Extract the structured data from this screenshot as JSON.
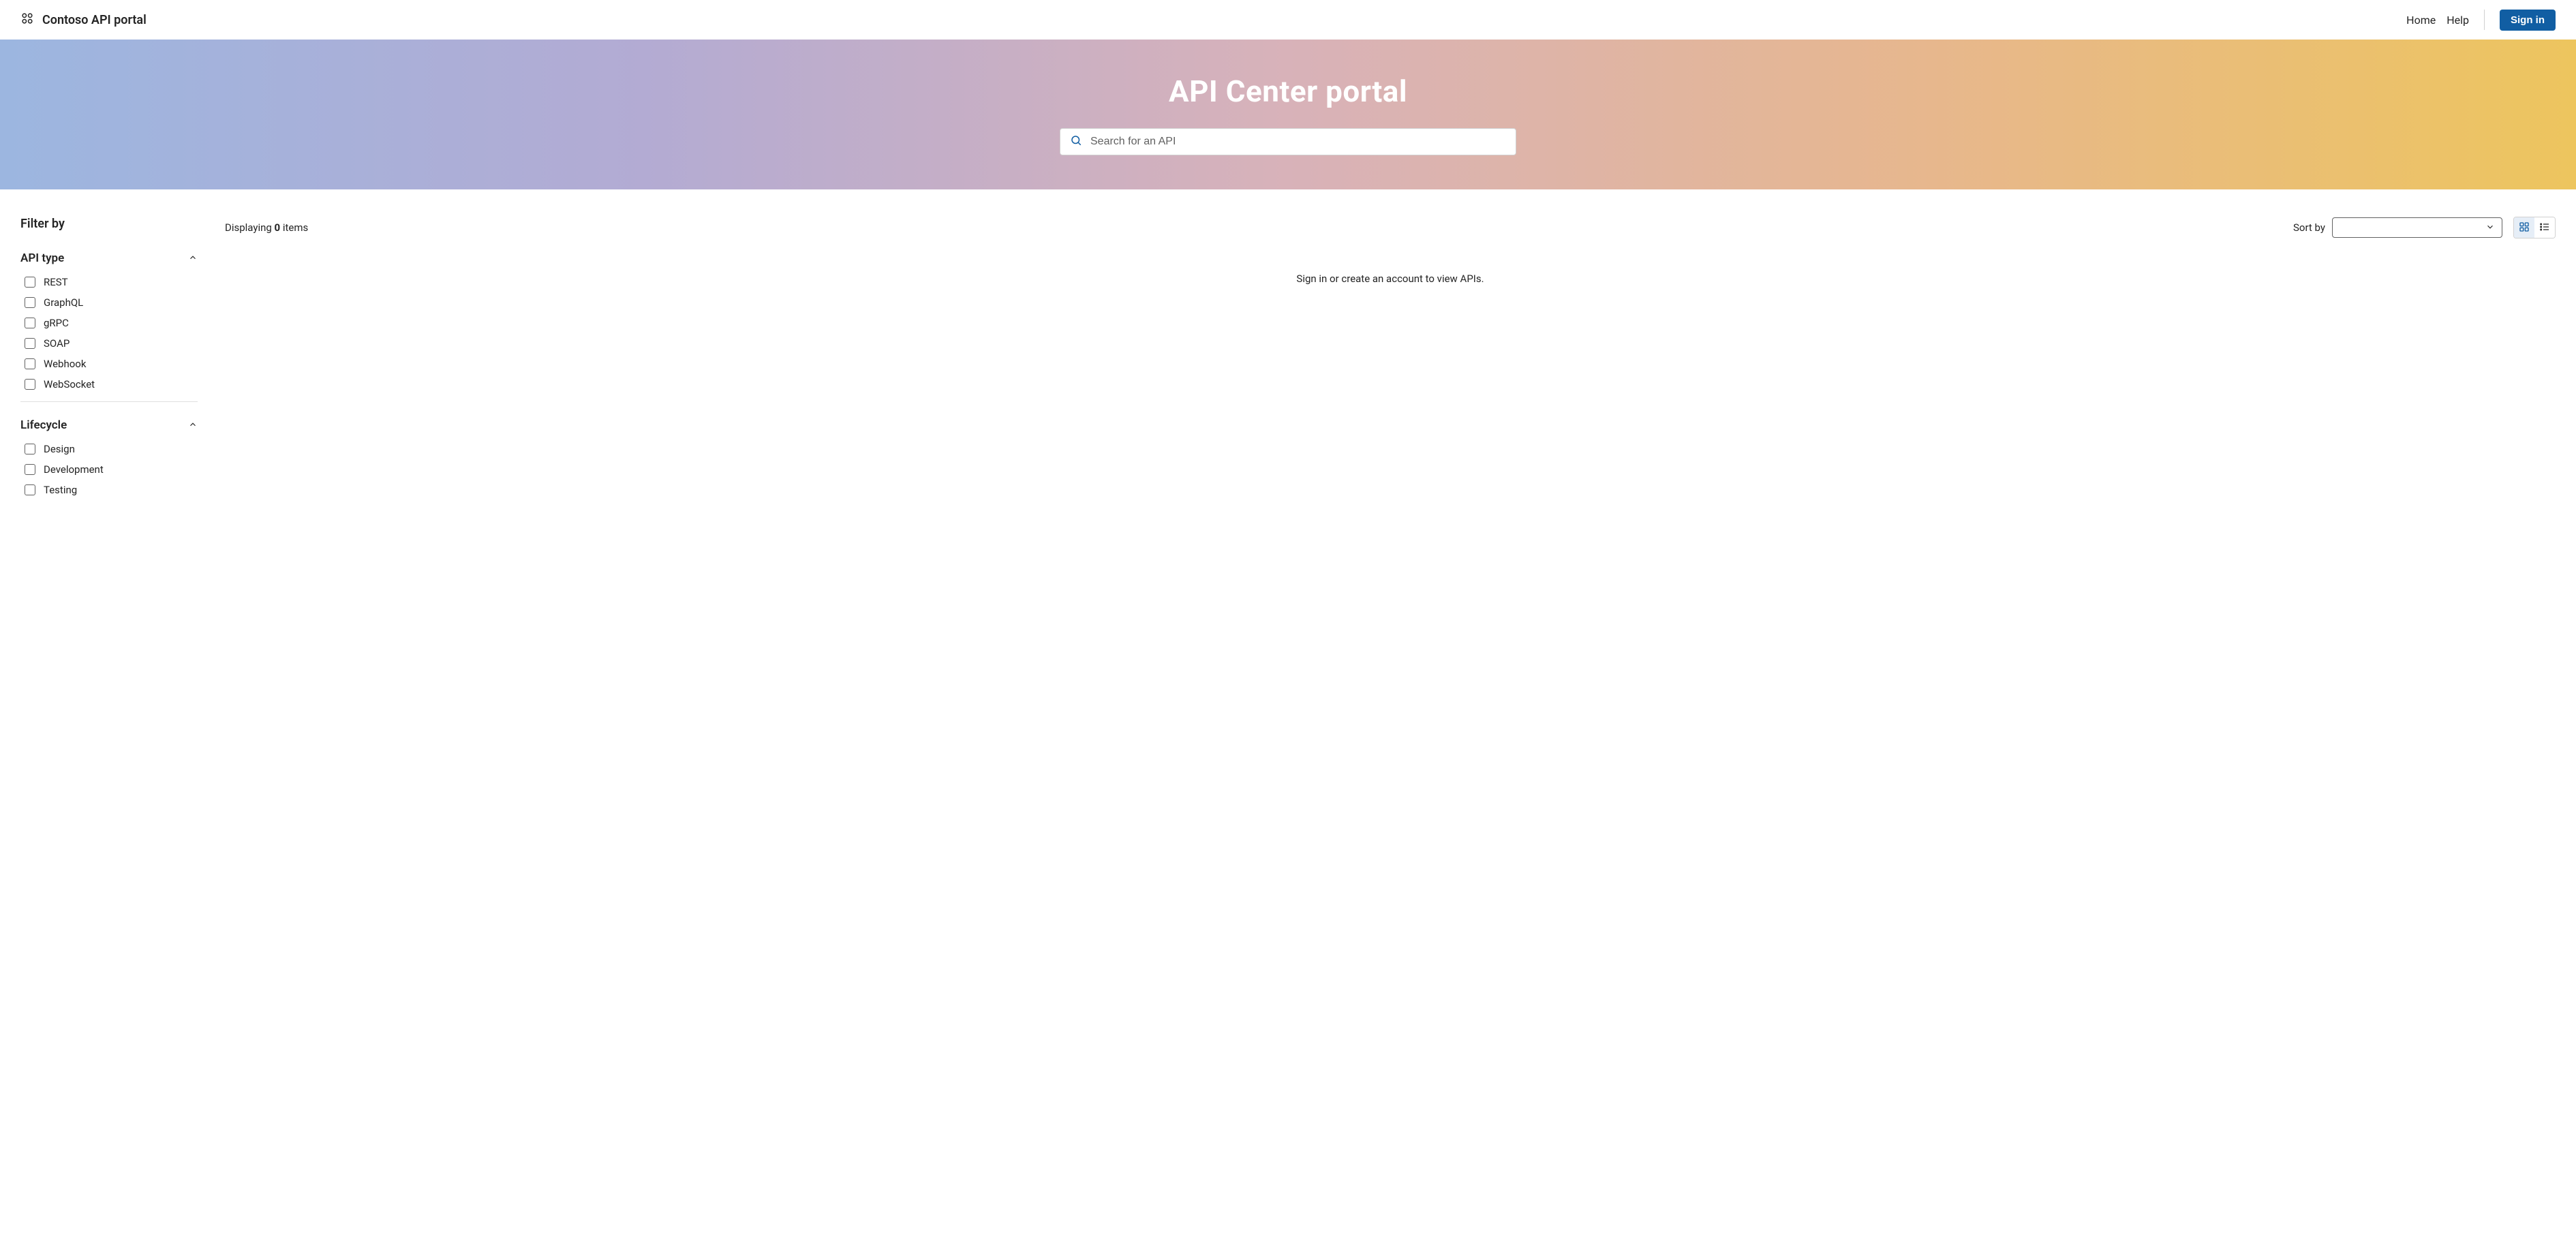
{
  "header": {
    "brand": "Contoso API portal",
    "nav": {
      "home": "Home",
      "help": "Help"
    },
    "signin": "Sign in"
  },
  "hero": {
    "title": "API Center portal",
    "search_placeholder": "Search for an API"
  },
  "filters": {
    "heading": "Filter by",
    "groups": [
      {
        "title": "API type",
        "options": [
          "REST",
          "GraphQL",
          "gRPC",
          "SOAP",
          "Webhook",
          "WebSocket"
        ]
      },
      {
        "title": "Lifecycle",
        "options": [
          "Design",
          "Development",
          "Testing"
        ]
      }
    ]
  },
  "results": {
    "displaying_prefix": "Displaying ",
    "count": "0",
    "displaying_suffix": " items",
    "sort_label": "Sort by",
    "empty_message": "Sign in or create an account to view APIs."
  }
}
